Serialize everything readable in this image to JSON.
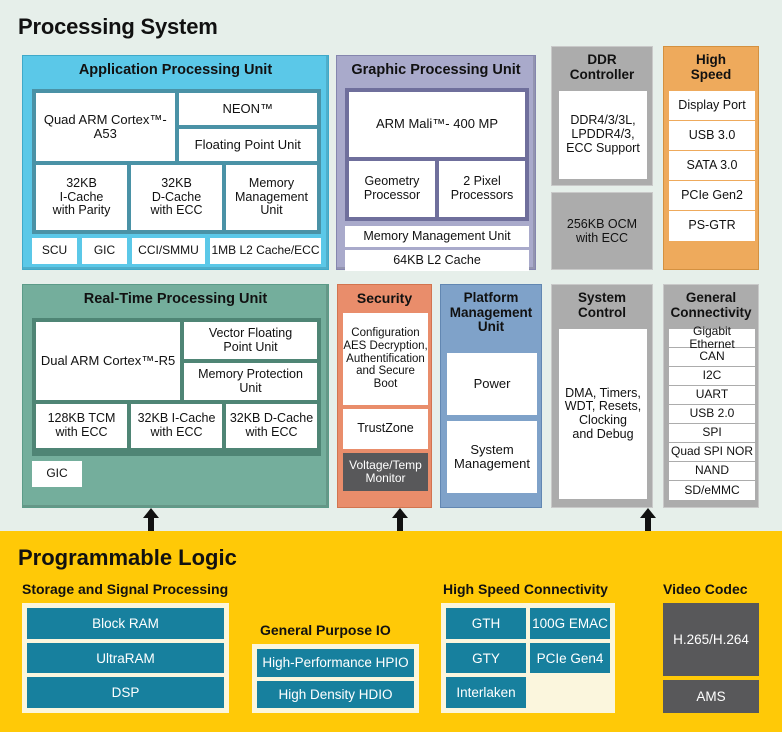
{
  "processing_system": {
    "title": "Processing System",
    "apu": {
      "header": "Application Processing Unit",
      "core": "Quad ARM Cortex™-A53",
      "neon": "NEON™",
      "fpu": "Floating Point Unit",
      "caches": [
        "32KB\nI-Cache\nwith Parity",
        "32KB\nD-Cache\nwith ECC",
        "Memory\nManagement\nUnit"
      ],
      "bottom": [
        "SCU",
        "GIC",
        "CCI/SMMU",
        "1MB L2 Cache/ECC"
      ],
      "color": "#5bc8e8"
    },
    "gpu": {
      "header": "Graphic Processing Unit",
      "mali": "ARM Mali™- 400 MP",
      "geometry": "Geometry\nProcessor",
      "pixel": "2 Pixel\nProcessors",
      "mmu": "Memory Management Unit",
      "l2": "64KB L2 Cache",
      "color": "#a9aacb"
    },
    "ddr": {
      "header": "DDR\nController",
      "detail": "DDR4/3/3L,\nLPDDR4/3,\nECC Support",
      "ocm": "256KB OCM\nwith ECC",
      "color": "#acacac"
    },
    "high_speed": {
      "header": "High\nSpeed",
      "items": [
        "Display Port",
        "USB 3.0",
        "SATA 3.0",
        "PCIe Gen2",
        "PS-GTR"
      ],
      "color": "#eeaa5c"
    },
    "rpu": {
      "header": "Real-Time Processing Unit",
      "core": "Dual ARM Cortex™-R5",
      "vfpu": "Vector Floating\nPoint Unit",
      "mpu": "Memory Protection\nUnit",
      "caches": [
        "128KB TCM\nwith ECC",
        "32KB I-Cache\nwith ECC",
        "32KB D-Cache\nwith ECC"
      ],
      "gic": "GIC",
      "color": "#74ae9c"
    },
    "security": {
      "header": "Security",
      "config": "Configuration\nAES Decryption,\nAuthentification\nand Secure Boot",
      "trustzone": "TrustZone",
      "monitor": "Voltage/Temp\nMonitor",
      "color": "#e98d6b"
    },
    "pmu": {
      "header": "Platform\nManagement\nUnit",
      "power": "Power",
      "system_management": "System\nManagement",
      "color": "#7fa2c9"
    },
    "system_control": {
      "header": "System\nControl",
      "detail": "DMA, Timers,\nWDT, Resets,\nClocking\nand Debug",
      "color": "#acacac"
    },
    "general_connectivity": {
      "header": "General\nConnectivity",
      "items": [
        "Gigabit Ethernet",
        "CAN",
        "I2C",
        "UART",
        "USB 2.0",
        "SPI",
        "Quad SPI NOR",
        "NAND",
        "SD/eMMC"
      ],
      "color": "#acacac"
    }
  },
  "programmable_logic": {
    "title": "Programmable Logic",
    "background": "#ffc907",
    "storage": {
      "header": "Storage and Signal Processing",
      "items": [
        "Block RAM",
        "UltraRAM",
        "DSP"
      ]
    },
    "gpio": {
      "header": "General Purpose IO",
      "items": [
        "High-Performance HPIO",
        "High Density HDIO"
      ]
    },
    "high_speed_connectivity": {
      "header": "High Speed Connectivity",
      "col1": [
        "GTH",
        "GTY",
        "Interlaken"
      ],
      "col2": [
        "100G EMAC",
        "PCIe Gen4"
      ]
    },
    "video_codec": {
      "header": "Video Codec",
      "codec": "H.265/H.264",
      "ams": "AMS"
    }
  },
  "connectors": {
    "count": 3,
    "label": "bidirectional-arrow"
  }
}
